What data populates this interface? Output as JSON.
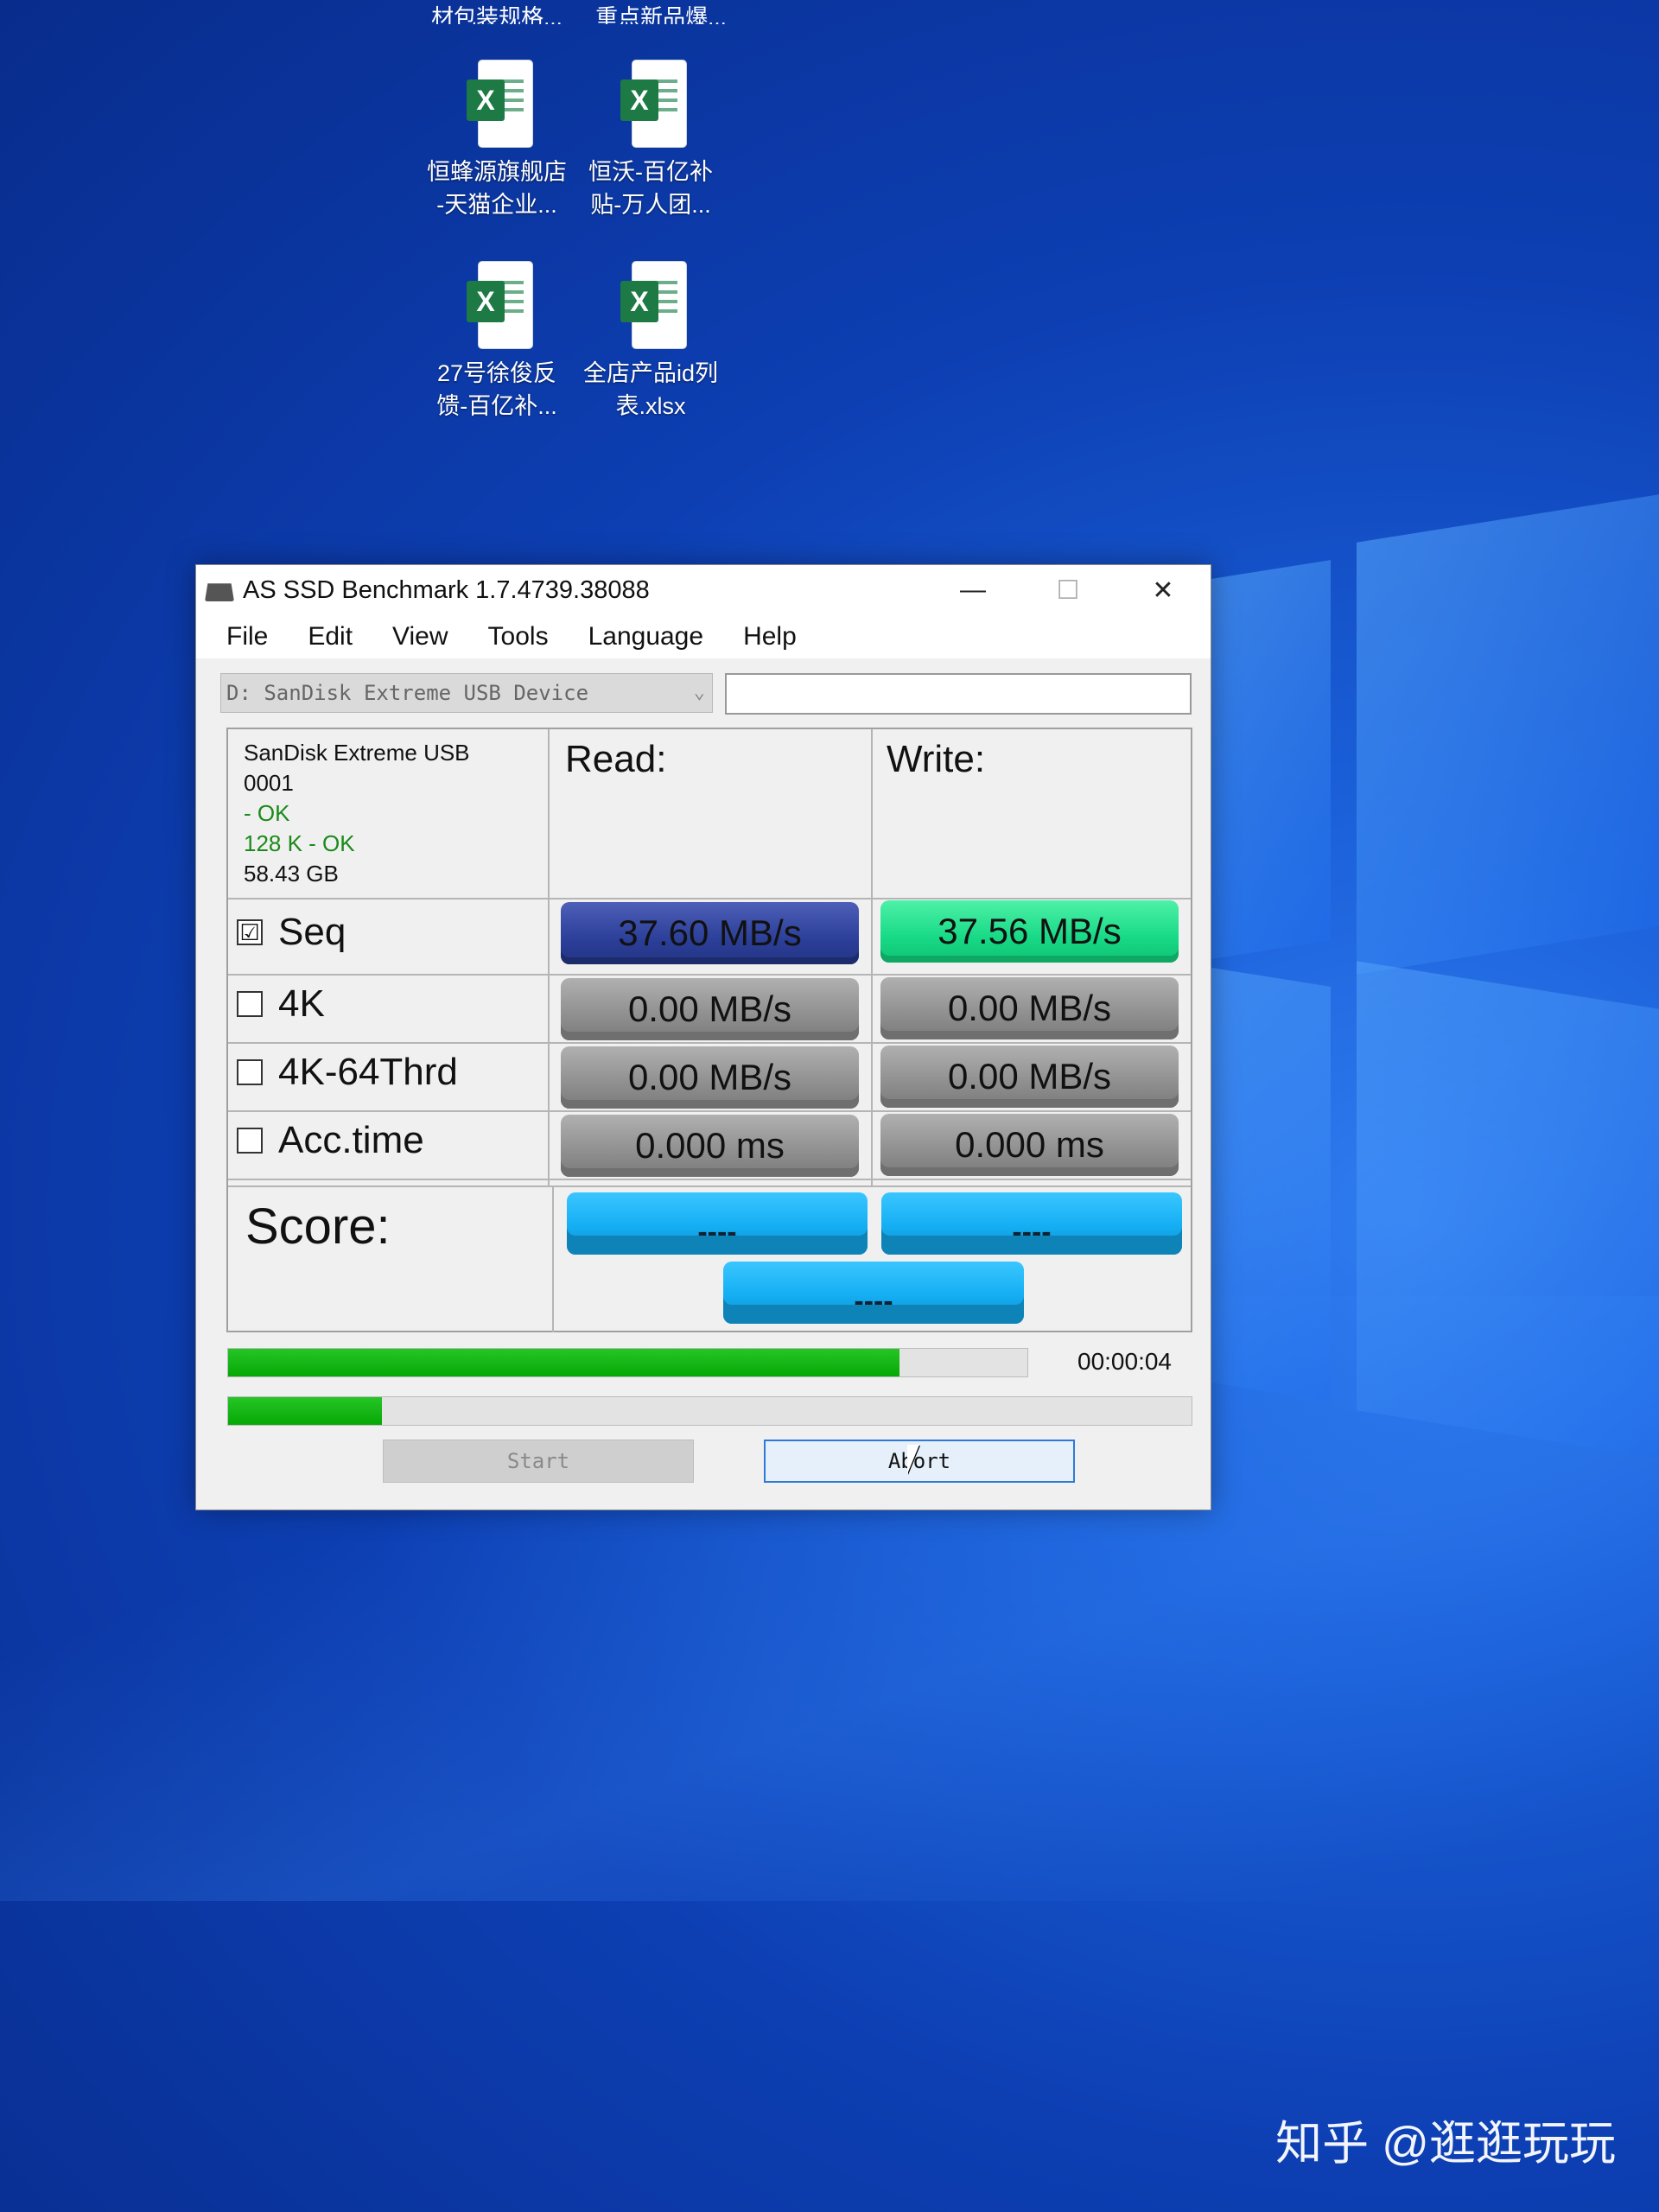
{
  "desktop": {
    "top_labels": [
      "材包装规格...",
      "重点新品爆..."
    ],
    "icons": [
      {
        "badge": "X",
        "line1": "恒蜂源旗舰店",
        "line2": "-天猫企业..."
      },
      {
        "badge": "X",
        "line1": "恒沃-百亿补",
        "line2": "贴-万人团..."
      },
      {
        "badge": "X",
        "line1": "27号徐俊反",
        "line2": "馈-百亿补..."
      },
      {
        "badge": "X",
        "line1": "全店产品id列",
        "line2": "表.xlsx"
      }
    ]
  },
  "window": {
    "title": "AS SSD Benchmark 1.7.4739.38088",
    "controls": {
      "minimize": "—",
      "maximize": "☐",
      "close": "✕"
    },
    "menu": [
      "File",
      "Edit",
      "View",
      "Tools",
      "Language",
      "Help"
    ],
    "drive_select": "D: SanDisk Extreme USB Device",
    "drive_text": "",
    "info": {
      "model": "SanDisk Extreme USB",
      "firmware": "0001",
      "driver_status": " - OK",
      "align_status": "128 K - OK",
      "capacity": "58.43 GB"
    },
    "headers": {
      "read": "Read:",
      "write": "Write:"
    },
    "rows": [
      {
        "label": "Seq",
        "checked": true,
        "read": "37.60 MB/s",
        "write": "37.56 MB/s"
      },
      {
        "label": "4K",
        "checked": false,
        "read": "0.00 MB/s",
        "write": "0.00 MB/s"
      },
      {
        "label": "4K-64Thrd",
        "checked": false,
        "read": "0.00 MB/s",
        "write": "0.00 MB/s"
      },
      {
        "label": "Acc.time",
        "checked": false,
        "read": "0.000 ms",
        "write": "0.000 ms"
      }
    ],
    "score": {
      "label": "Score:",
      "read": "----",
      "write": "----",
      "total": "----"
    },
    "progress": {
      "current_fraction": 0.84,
      "overall_fraction": 0.16,
      "elapsed": "00:00:04"
    },
    "buttons": {
      "start": "Start",
      "abort": "Abort"
    }
  },
  "watermark": "知乎 @逛逛玩玩"
}
